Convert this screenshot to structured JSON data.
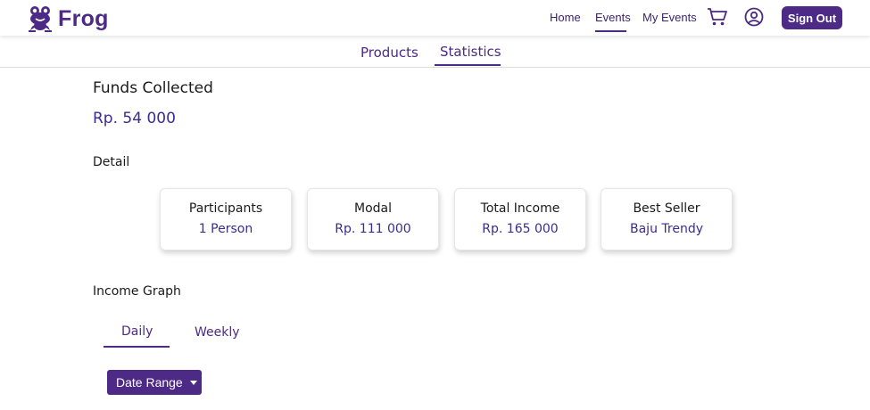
{
  "brand": {
    "name": "Frog",
    "logo_icon": "frog-icon",
    "accent": "#4c2a85"
  },
  "nav": {
    "home": "Home",
    "events": "Events",
    "my_events": "My Events",
    "cart_icon": "cart-icon",
    "user_icon": "user-circle-icon",
    "sign_out": "Sign Out"
  },
  "subnav": {
    "products": "Products",
    "statistics": "Statistics",
    "active": "Statistics"
  },
  "funds": {
    "title": "Funds Collected",
    "value": "Rp. 54 000"
  },
  "detail": {
    "title": "Detail",
    "cards": [
      {
        "label": "Participants",
        "value": "1 Person"
      },
      {
        "label": "Modal",
        "value": "Rp. 111 000"
      },
      {
        "label": "Total Income",
        "value": "Rp. 165 000"
      },
      {
        "label": "Best Seller",
        "value": "Baju Trendy"
      }
    ]
  },
  "graph": {
    "title": "Income Graph",
    "tabs": [
      "Daily",
      "Weekly"
    ],
    "active_tab": "Daily",
    "date_range_label": "Date Range"
  }
}
